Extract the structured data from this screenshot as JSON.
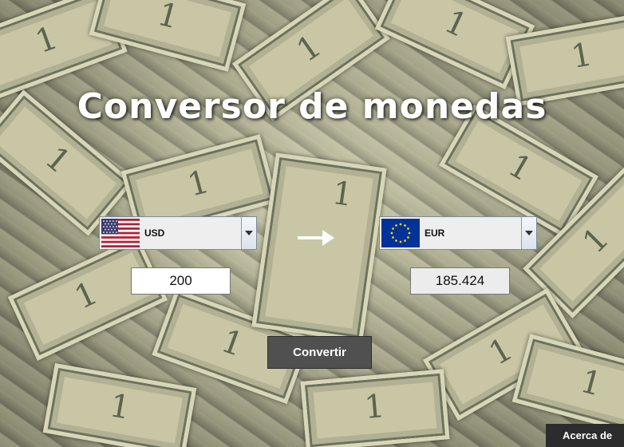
{
  "app": {
    "title": "Conversor de monedas"
  },
  "from": {
    "currency_code": "USD",
    "flag_icon": "us-flag-icon",
    "amount": "200"
  },
  "to": {
    "currency_code": "EUR",
    "flag_icon": "eu-flag-icon",
    "amount": "185.424"
  },
  "actions": {
    "convert_label": "Convertir",
    "about_label": "Acerca de"
  },
  "colors": {
    "title_text": "#ffffff",
    "button_bg": "#505050",
    "about_bg": "#2c2c2c",
    "combo_border": "#7a8da3"
  }
}
